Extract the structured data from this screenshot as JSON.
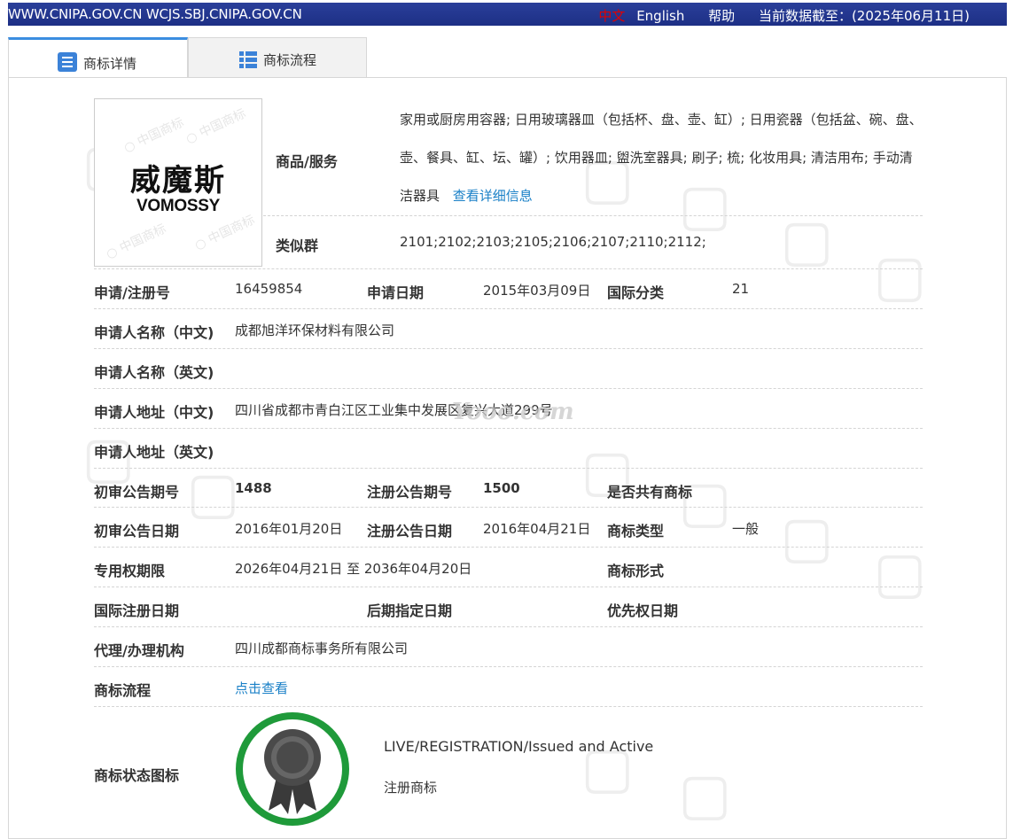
{
  "topbar": {
    "url_text": "WWW.CNIPA.GOV.CN WCJS.SBJ.CNIPA.GOV.CN",
    "lang_cn": "中文",
    "lang_en": "English",
    "help": "帮助",
    "data_date": "当前数据截至：(2025年06月11日)"
  },
  "tabs": {
    "detail": "商标详情",
    "flow": "商标流程"
  },
  "logo": {
    "cn": "威魔斯",
    "en": "VOMOSSY"
  },
  "goods": {
    "label": "商品/服务",
    "text": "家用或厨房用容器; 日用玻璃器皿（包括杯、盘、壶、缸）; 日用瓷器（包括盆、碗、盘、壶、餐具、缸、坛、罐）; 饮用器皿; 盥洗室器具; 刷子; 梳; 化妆用具; 清洁用布; 手动清洁器具",
    "more_link": "查看详细信息"
  },
  "similar_group": {
    "label": "类似群",
    "value": "2101;2102;2103;2105;2106;2107;2110;2112;"
  },
  "fields": {
    "reg_no_label": "申请/注册号",
    "reg_no": "16459854",
    "app_date_label": "申请日期",
    "app_date": "2015年03月09日",
    "intl_class_label": "国际分类",
    "intl_class": "21",
    "applicant_cn_label": "申请人名称（中文)",
    "applicant_cn": "成都旭洋环保材料有限公司",
    "applicant_en_label": "申请人名称（英文)",
    "address_cn_label": "申请人地址（中文)",
    "address_cn": "四川省成都市青白江区工业集中发展区复兴大道299号",
    "address_en_label": "申请人地址（英文)",
    "prelim_issue_label": "初审公告期号",
    "prelim_issue": "1488",
    "reg_issue_label": "注册公告期号",
    "reg_issue": "1500",
    "shared_label": "是否共有商标",
    "prelim_date_label": "初审公告日期",
    "prelim_date": "2016年01月20日",
    "reg_date_label": "注册公告日期",
    "reg_date": "2016年04月21日",
    "tm_type_label": "商标类型",
    "tm_type": "一般",
    "exclusive_label": "专用权期限",
    "exclusive": "2026年04月21日 至 2036年04月20日",
    "tm_form_label": "商标形式",
    "intl_reg_date_label": "国际注册日期",
    "later_designation_label": "后期指定日期",
    "priority_date_label": "优先权日期",
    "agent_label": "代理/办理机构",
    "agent": "四川成都商标事务所有限公司",
    "flow_label": "商标流程",
    "flow_link": "点击查看",
    "status_icon_label": "商标状态图标",
    "status_en": "LIVE/REGISTRATION/Issued and Active",
    "status_cn": "注册商标"
  },
  "watermark_text": "Yooo.com",
  "colors": {
    "topbar": "#1d2f85",
    "link": "#1a80c7",
    "badge_ring": "#1f9a3a",
    "lang_active": "#e00000"
  }
}
